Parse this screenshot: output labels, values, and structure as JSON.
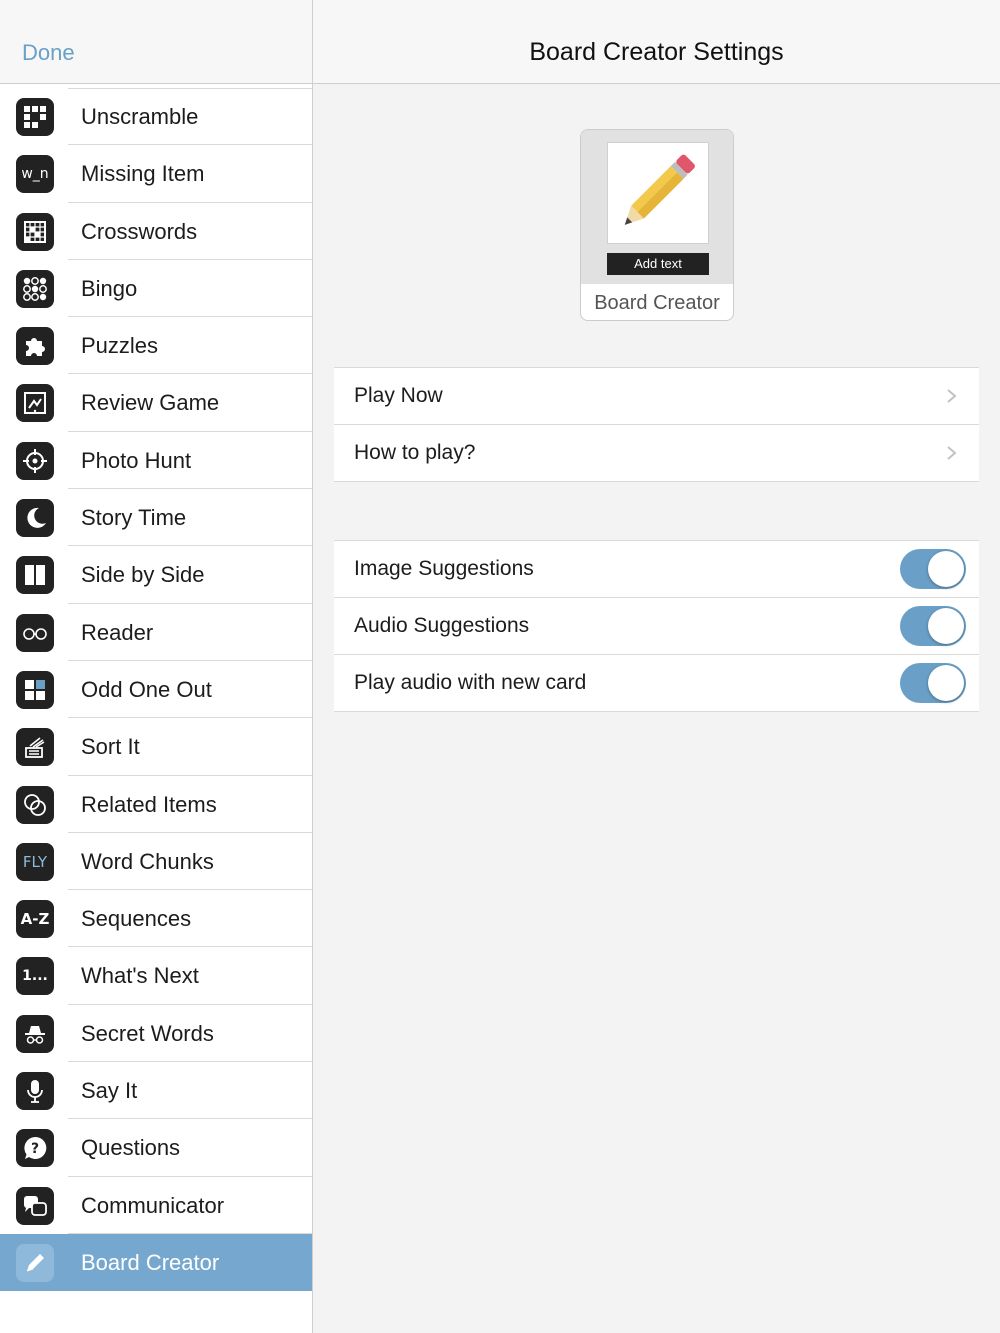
{
  "sidebar": {
    "done_label": "Done",
    "items": [
      {
        "label": "Unscramble",
        "icon": "grid-scramble-icon"
      },
      {
        "label": "Missing Item",
        "icon": "missing-letter-icon",
        "glyph": "w_n"
      },
      {
        "label": "Crosswords",
        "icon": "crossword-grid-icon"
      },
      {
        "label": "Bingo",
        "icon": "bingo-dots-icon"
      },
      {
        "label": "Puzzles",
        "icon": "puzzle-piece-icon"
      },
      {
        "label": "Review Game",
        "icon": "review-board-icon"
      },
      {
        "label": "Photo Hunt",
        "icon": "crosshair-icon"
      },
      {
        "label": "Story Time",
        "icon": "moon-icon"
      },
      {
        "label": "Side by Side",
        "icon": "two-columns-icon"
      },
      {
        "label": "Reader",
        "icon": "glasses-icon"
      },
      {
        "label": "Odd One Out",
        "icon": "four-squares-icon"
      },
      {
        "label": "Sort It",
        "icon": "sort-stack-icon"
      },
      {
        "label": "Related Items",
        "icon": "linked-circles-icon"
      },
      {
        "label": "Word Chunks",
        "icon": "word-chunks-icon",
        "glyph": "FLY"
      },
      {
        "label": "Sequences",
        "icon": "a-to-z-icon",
        "glyph": "A-Z"
      },
      {
        "label": "What's Next",
        "icon": "numbered-sequence-icon",
        "glyph": "1..."
      },
      {
        "label": "Secret Words",
        "icon": "spy-icon"
      },
      {
        "label": "Say It",
        "icon": "microphone-icon"
      },
      {
        "label": "Questions",
        "icon": "question-bubble-icon"
      },
      {
        "label": "Communicator",
        "icon": "chat-bubbles-icon"
      },
      {
        "label": "Board Creator",
        "icon": "pencil-icon",
        "active": true
      }
    ]
  },
  "main": {
    "title": "Board Creator Settings",
    "card": {
      "add_text_label": "Add text",
      "label": "Board Creator"
    },
    "nav_rows": [
      {
        "label": "Play Now"
      },
      {
        "label": "How to play?"
      }
    ],
    "toggle_rows": [
      {
        "label": "Image Suggestions",
        "on": true
      },
      {
        "label": "Audio Suggestions",
        "on": true
      },
      {
        "label": "Play audio with new card",
        "on": true
      }
    ]
  },
  "colors": {
    "accent": "#6aa0c8",
    "active_row": "#76a8cf",
    "icon_bg": "#222222"
  }
}
